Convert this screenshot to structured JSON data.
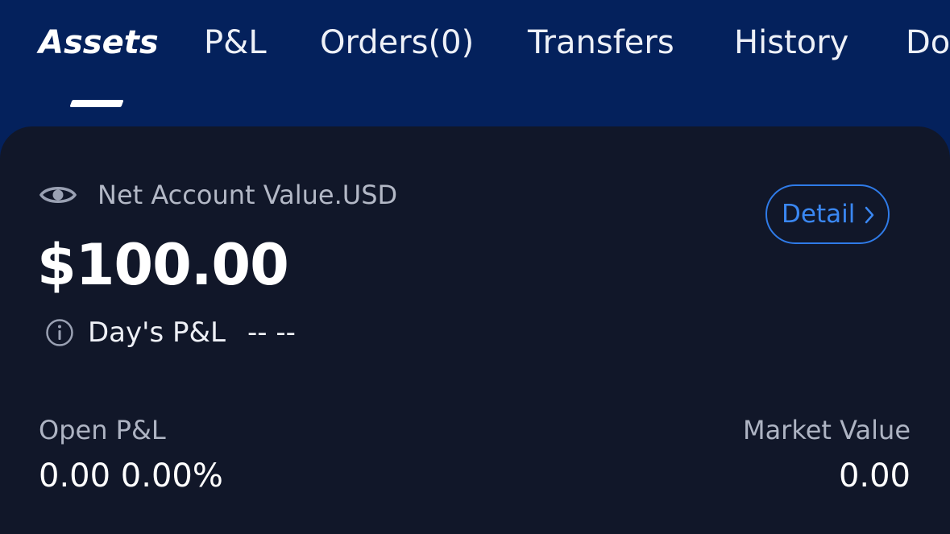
{
  "tabs": [
    {
      "label": "Assets",
      "active": true
    },
    {
      "label": "P&L",
      "active": false
    },
    {
      "label": "Orders(0)",
      "active": false
    },
    {
      "label": "Transfers",
      "active": false
    },
    {
      "label": "History",
      "active": false
    },
    {
      "label": "Do",
      "active": false
    }
  ],
  "account": {
    "net_value_label": "Net Account Value.USD",
    "net_value": "$100.00",
    "detail_label": "Detail",
    "days_pl_label": "Day's P&L",
    "days_pl_value": "-- --"
  },
  "summary": {
    "open_pl_label": "Open P&L",
    "open_pl_value": "0.00 0.00%",
    "market_value_label": "Market Value",
    "market_value_value": "0.00"
  },
  "icons": {
    "visibility": "eye-icon",
    "info": "info-icon",
    "detail_chevron": "chevron-right-icon"
  },
  "colors": {
    "header_bg": "#04215c",
    "card_bg": "#111729",
    "accent": "#2f7be8"
  }
}
